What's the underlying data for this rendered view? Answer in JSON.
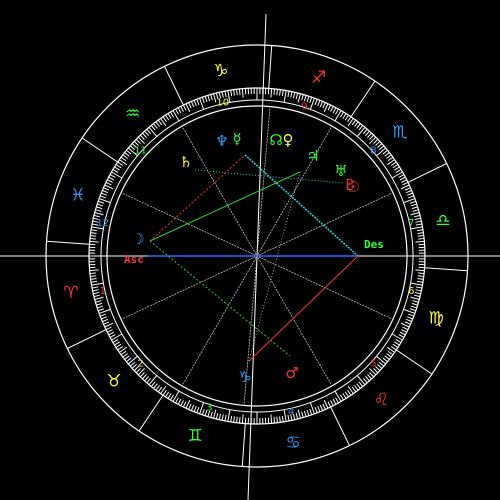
{
  "colors": {
    "background": "#000000",
    "wheel": "#ffffff",
    "fire": "#ff3333",
    "earth": "#ffff33",
    "air": "#33ff33",
    "water": "#3399ff",
    "grid": "#cccccc",
    "opposition": "#ff3333",
    "trine": "#33cc33",
    "square": "#ff3333",
    "sextile": "#3366ff",
    "conjunction": "#33cccc"
  },
  "signs": [
    {
      "icon": "aries-glyph",
      "text": "♈",
      "color": "#ff3333"
    },
    {
      "icon": "taurus-glyph",
      "text": "♉",
      "color": "#ffff33"
    },
    {
      "icon": "gemini-glyph",
      "text": "♊",
      "color": "#33ff33"
    },
    {
      "icon": "cancer-glyph",
      "text": "♋",
      "color": "#3399ff"
    },
    {
      "icon": "leo-glyph",
      "text": "♌",
      "color": "#ff3333"
    },
    {
      "icon": "virgo-glyph",
      "text": "♍",
      "color": "#ffff33"
    },
    {
      "icon": "libra-glyph",
      "text": "♎",
      "color": "#33ff33"
    },
    {
      "icon": "scorpio-glyph",
      "text": "♏",
      "color": "#3399ff"
    },
    {
      "icon": "sagittarius-glyph",
      "text": "♐",
      "color": "#ff3333"
    },
    {
      "icon": "capricorn-glyph",
      "text": "♑",
      "color": "#ffff33"
    },
    {
      "icon": "aquarius-glyph",
      "text": "♒",
      "color": "#33ff33"
    },
    {
      "icon": "pisces-glyph",
      "text": "♓",
      "color": "#3399ff"
    }
  ],
  "houses": [
    {
      "label": "1",
      "color": "#ff3333"
    },
    {
      "label": "2",
      "color": "#ffff33"
    },
    {
      "label": "3",
      "color": "#33ff33"
    },
    {
      "label": "4",
      "color": "#3399ff"
    },
    {
      "label": "5",
      "color": "#ff3333"
    },
    {
      "label": "6",
      "color": "#ffff33"
    },
    {
      "label": "7",
      "color": "#33ff33"
    },
    {
      "label": "8",
      "color": "#3399ff"
    },
    {
      "label": "9",
      "color": "#ff3333"
    },
    {
      "label": "10",
      "color": "#ffff33"
    },
    {
      "label": "11",
      "color": "#33ff33"
    },
    {
      "label": "12",
      "color": "#3399ff"
    }
  ],
  "angles": {
    "asc": {
      "label": "Asc",
      "color": "#ff3333"
    },
    "des": {
      "label": "Des",
      "color": "#33ff33"
    }
  },
  "planets": [
    {
      "icon": "moon-glyph",
      "text": "☽",
      "color": "#3399ff"
    },
    {
      "icon": "saturn-glyph",
      "text": "♄",
      "color": "#ffff33"
    },
    {
      "icon": "neptune-glyph",
      "text": "♆",
      "color": "#3399ff"
    },
    {
      "icon": "jupiter-glyph",
      "text": "♃",
      "color": "#33ff33"
    },
    {
      "icon": "pluto-glyph",
      "text": "♇",
      "color": "#ff3333"
    },
    {
      "icon": "mercury-glyph",
      "text": "☿",
      "color": "#33ff33"
    },
    {
      "icon": "venus-glyph",
      "text": "♀",
      "color": "#ffff33"
    },
    {
      "icon": "uranus-glyph",
      "text": "♅",
      "color": "#33ff33"
    },
    {
      "icon": "node-glyph",
      "text": "☊",
      "color": "#33ff33"
    },
    {
      "icon": "sun-glyph",
      "text": "☉",
      "color": "#ff3333"
    },
    {
      "icon": "mc-glyph",
      "text": "♑",
      "color": "#3399ff"
    },
    {
      "icon": "mars-glyph",
      "text": "♂",
      "color": "#ff3333"
    }
  ]
}
